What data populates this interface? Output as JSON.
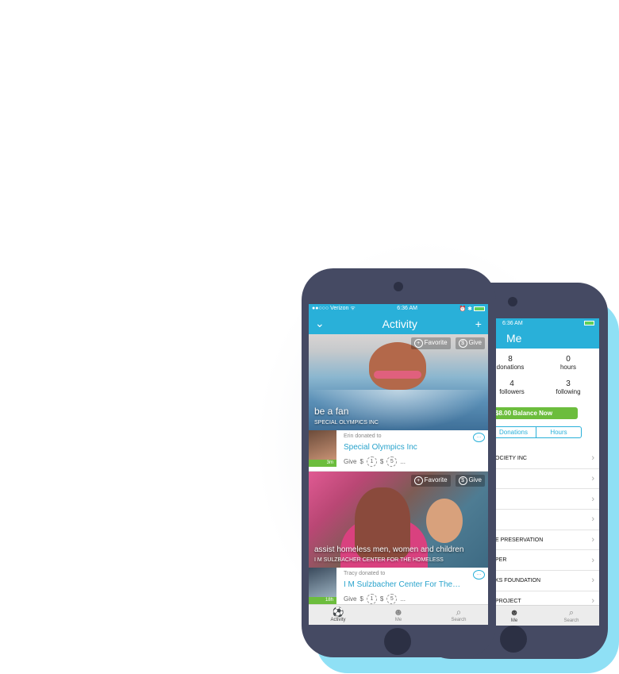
{
  "back_phone": {
    "status_time": "6:36 AM",
    "title": "Me",
    "stats": [
      {
        "value": "8",
        "label": "donations"
      },
      {
        "value": "0",
        "label": "hours"
      },
      {
        "value": "4",
        "label": "followers"
      },
      {
        "value": "3",
        "label": "following"
      }
    ],
    "balance_label": "$8.00 Balance Now",
    "segments": [
      "Donations",
      "Hours"
    ],
    "list": [
      "OCIETY INC",
      "",
      "",
      "",
      "E PRESERVATION",
      "PER",
      "KS FOUNDATION",
      "PROJECT"
    ],
    "chevron": "›",
    "tabs": [
      {
        "label": "Me",
        "icon": "person-icon",
        "glyph": "☻"
      },
      {
        "label": "Search",
        "icon": "search-icon",
        "glyph": "⌕"
      }
    ]
  },
  "front_phone": {
    "status": {
      "carrier": "●●○○○ Verizon ᯤ",
      "time": "6:36 AM",
      "right": "⏰ ✱"
    },
    "title": "Activity",
    "back_glyph": "⌄",
    "add_glyph": "+",
    "favorite_label": "Favorite",
    "give_label": "Give",
    "plus_glyph": "+",
    "dollar_glyph": "$",
    "cards": [
      {
        "caption": "be a fan",
        "org_caption": "SPECIAL OLYMPICS INC"
      },
      {
        "caption": "assist homeless men, women and children",
        "org_caption": "I M SULZBACHER CENTER FOR THE HOMELESS"
      }
    ],
    "donations": [
      {
        "who": "Erin donated to",
        "org": "Special Olympics Inc",
        "time": "3m",
        "give": "Give",
        "amounts": [
          "$",
          "1",
          "$",
          "5",
          "..."
        ]
      },
      {
        "who": "Tracy donated to",
        "org": "I M Sulzbacher Center For The…",
        "time": "18h",
        "give": "Give",
        "amounts": [
          "$",
          "1",
          "$",
          "5",
          "..."
        ]
      }
    ],
    "comment_glyph": "…",
    "tabs": [
      {
        "label": "Activity",
        "icon": "activity-icon",
        "glyph": "⚽"
      },
      {
        "label": "Me",
        "icon": "person-icon",
        "glyph": "☻"
      },
      {
        "label": "Search",
        "icon": "search-icon",
        "glyph": "⌕"
      }
    ]
  }
}
